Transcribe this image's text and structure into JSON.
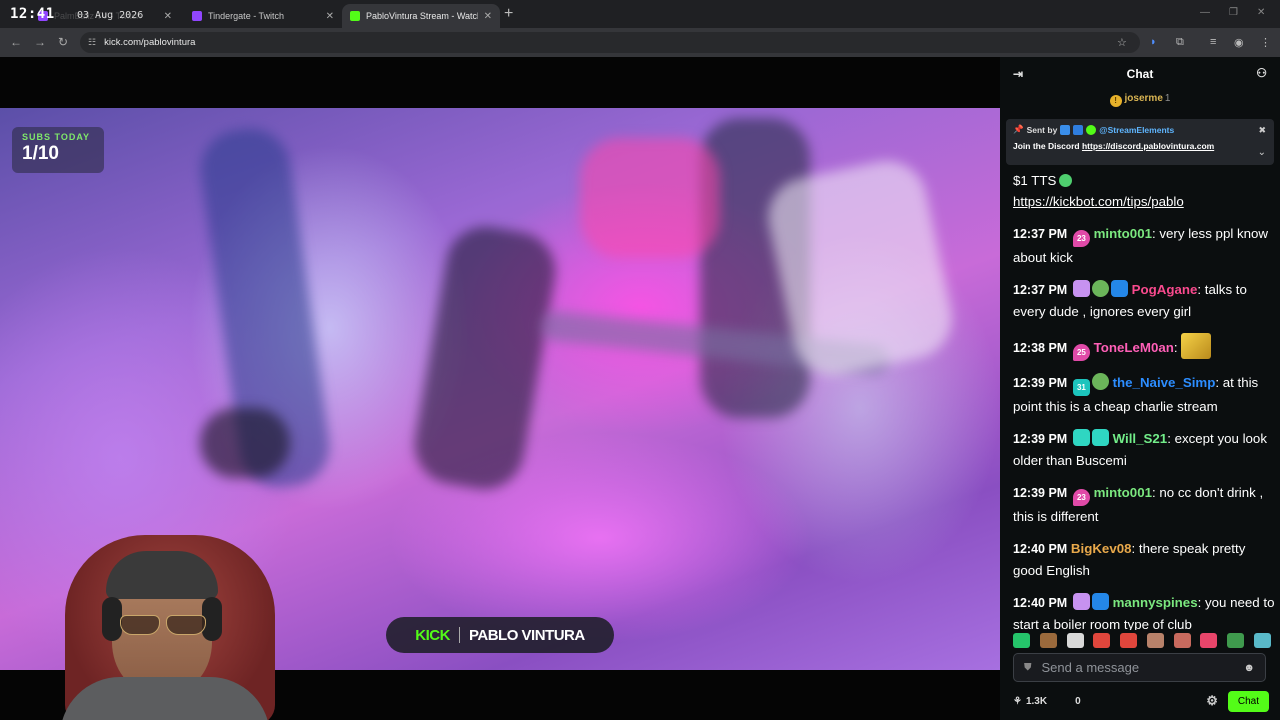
{
  "system": {
    "clock": "12:41",
    "date": "03 Aug 2026"
  },
  "tabs": [
    {
      "label": "PalmBallz TV - Twitch",
      "favicon_color": "#9146ff"
    },
    {
      "label": "Tindergate - Twitch",
      "favicon_color": "#9146ff"
    },
    {
      "label": "PabloVintura Stream - Watch",
      "favicon_color": "#53fc18"
    }
  ],
  "browser": {
    "url": "kick.com/pablovintura",
    "new_tab": "+"
  },
  "stream": {
    "subs_widget": {
      "title": "SUBS TODAY",
      "count": "1/10"
    },
    "banner": {
      "brand": "KICK",
      "name": "PABLO VINTURA"
    }
  },
  "chat": {
    "title": "Chat",
    "top_gifter": {
      "name": "joserme",
      "count": "1"
    },
    "pinned": {
      "sent_by": "Sent by",
      "user": "@StreamElements",
      "text": "Join the Discord",
      "link": "https://discord.pablovintura.com"
    },
    "messages": [
      {
        "time": "",
        "user": "",
        "text": "$1 TTS",
        "link": "https://kickbot.com/tips/pablo"
      },
      {
        "time": "12:37 PM",
        "badge": "23",
        "user": "minto001",
        "text": "very less ppl know about kick"
      },
      {
        "time": "12:37 PM",
        "user": "PogAgane",
        "text": "talks to every dude , ignores every girl"
      },
      {
        "time": "12:38 PM",
        "badge": "25",
        "user": "ToneLeM0an",
        "text": ""
      },
      {
        "time": "12:39 PM",
        "badge": "31",
        "user": "the_Naive_Simp",
        "text": "at this point this is a cheap charlie stream"
      },
      {
        "time": "12:39 PM",
        "user": "Will_S21",
        "text": "except you look older than Buscemi"
      },
      {
        "time": "12:39 PM",
        "badge": "23",
        "user": "minto001",
        "text": "no cc don't drink , this is different"
      },
      {
        "time": "12:40 PM",
        "user": "BigKev08",
        "text": "there speak pretty good English"
      },
      {
        "time": "12:40 PM",
        "user": "mannyspines",
        "text": "you need to start a boiler room type of club"
      }
    ],
    "input_placeholder": "Send a message",
    "footer": {
      "viewers": "1.3K",
      "count": "0",
      "send_label": "Chat"
    }
  },
  "colors": {
    "kick_green": "#53fc18",
    "chat_bg": "#0b0e0f",
    "pinned_bg": "#24272c"
  }
}
